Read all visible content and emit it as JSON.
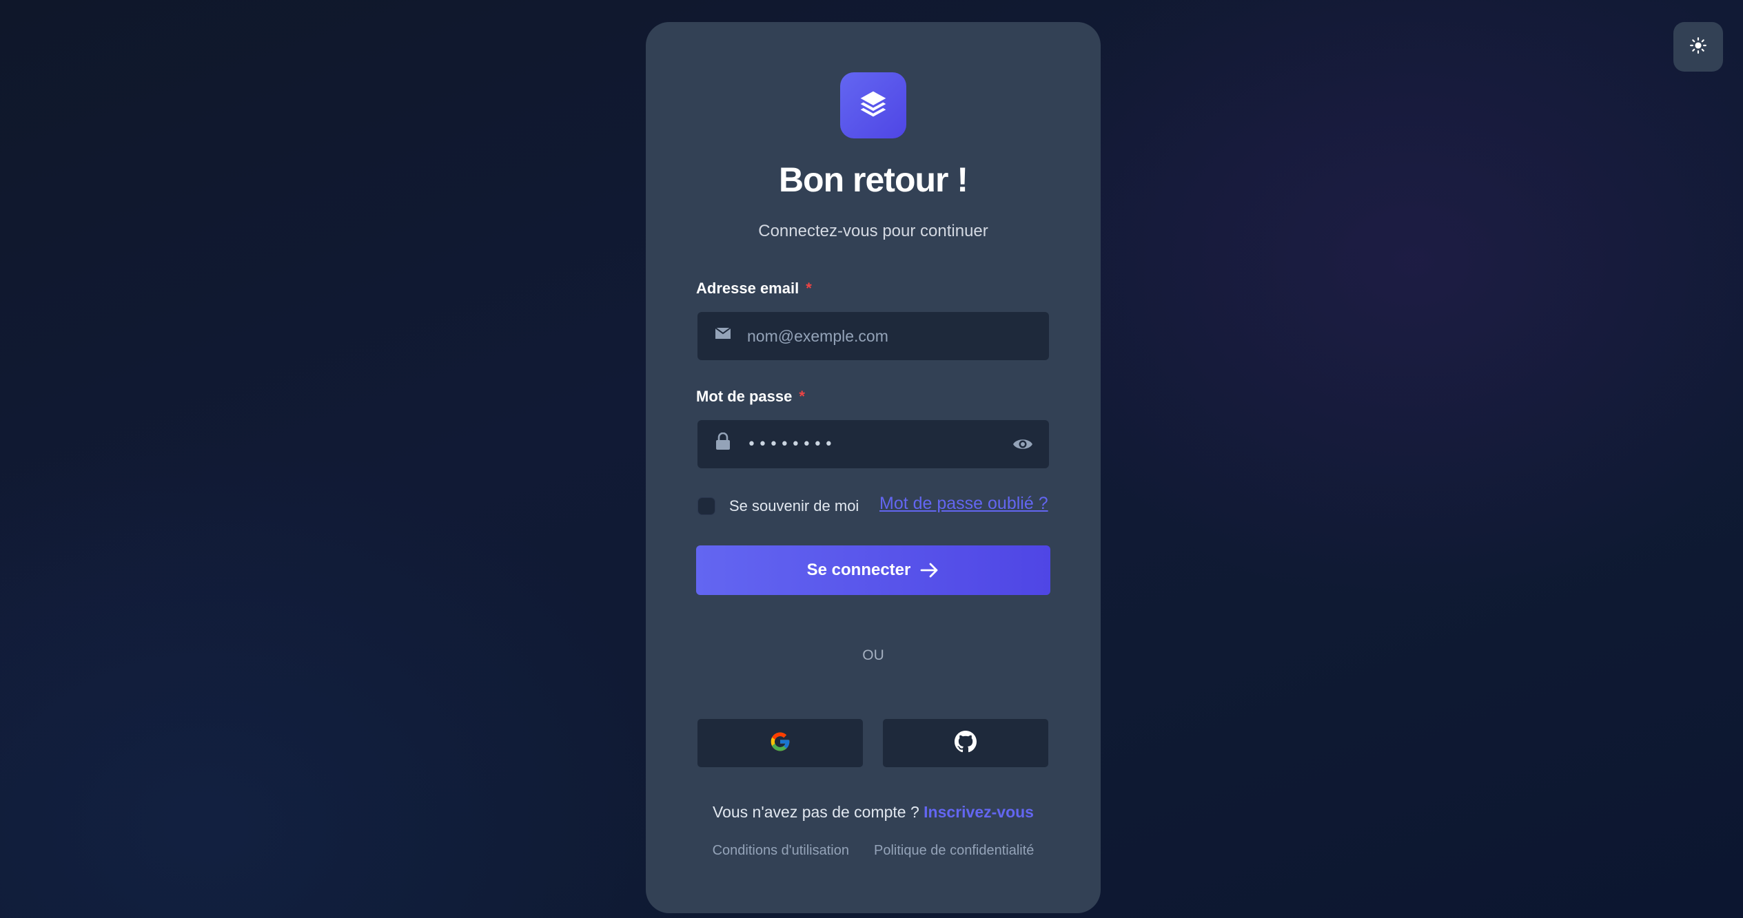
{
  "theme_toggle": {
    "icon": "sun-icon"
  },
  "card": {
    "logo_icon": "layers-icon",
    "title": "Bon retour !",
    "subtitle": "Connectez-vous pour continuer"
  },
  "email": {
    "label": "Adresse email",
    "required_mark": "*",
    "placeholder": "nom@exemple.com",
    "value": "",
    "icon": "mail-icon"
  },
  "password": {
    "label": "Mot de passe",
    "required_mark": "*",
    "masked_value": "••••••••",
    "icon": "lock-icon",
    "toggle_icon": "eye-icon"
  },
  "remember": {
    "label": "Se souvenir de moi",
    "checked": false
  },
  "forgot_link": "Mot de passe oublié ?",
  "submit": {
    "label": "Se connecter",
    "icon": "arrow-right-icon"
  },
  "divider_text": "OU",
  "social": {
    "google_icon": "google-icon",
    "github_icon": "github-icon"
  },
  "signup": {
    "prompt": "Vous n'avez pas de compte ?",
    "link": "Inscrivez-vous"
  },
  "footer": {
    "terms": "Conditions d'utilisation",
    "privacy": "Politique de confidentialité"
  },
  "colors": {
    "accent": "#6366f1",
    "card_bg": "#334155",
    "input_bg": "#1e293b",
    "required": "#ef4444"
  }
}
